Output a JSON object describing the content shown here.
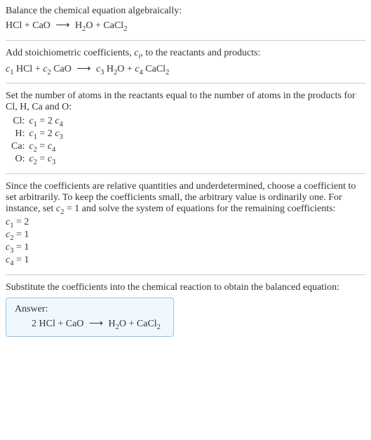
{
  "section1": {
    "title": "Balance the chemical equation algebraically:",
    "equation_parts": {
      "r1": "HCl",
      "r2": "CaO",
      "p1_base": "H",
      "p1_sub": "2",
      "p1_suffix": "O",
      "p2_base": "CaCl",
      "p2_sub": "2"
    }
  },
  "section2": {
    "text_before": "Add stoichiometric coefficients, ",
    "ci_base": "c",
    "ci_sub": "i",
    "text_after": ", to the reactants and products:",
    "c1": "c",
    "c1sub": "1",
    "r1": " HCl",
    "c2": "c",
    "c2sub": "2",
    "r2": " CaO",
    "c3": "c",
    "c3sub": "3",
    "p1a": " H",
    "p1sub": "2",
    "p1b": "O",
    "c4": "c",
    "c4sub": "4",
    "p2a": " CaCl",
    "p2sub": "2"
  },
  "section3": {
    "text": "Set the number of atoms in the reactants equal to the number of atoms in the products for Cl, H, Ca and O:",
    "rows": [
      {
        "label": "Cl:",
        "c": "c",
        "csub": "1",
        "eq": " = 2 ",
        "c2": "c",
        "c2sub": "4"
      },
      {
        "label": "H:",
        "c": "c",
        "csub": "1",
        "eq": " = 2 ",
        "c2": "c",
        "c2sub": "3"
      },
      {
        "label": "Ca:",
        "c": "c",
        "csub": "2",
        "eq": " = ",
        "c2": "c",
        "c2sub": "4"
      },
      {
        "label": "O:",
        "c": "c",
        "csub": "2",
        "eq": " = ",
        "c2": "c",
        "c2sub": "3"
      }
    ]
  },
  "section4": {
    "text_before": "Since the coefficients are relative quantities and underdetermined, choose a coefficient to set arbitrarily. To keep the coefficients small, the arbitrary value is ordinarily one. For instance, set ",
    "set_c": "c",
    "set_csub": "2",
    "set_val": " = 1",
    "text_after": " and solve the system of equations for the remaining coefficients:",
    "coefs": [
      {
        "c": "c",
        "csub": "1",
        "val": " = 2"
      },
      {
        "c": "c",
        "csub": "2",
        "val": " = 1"
      },
      {
        "c": "c",
        "csub": "3",
        "val": " = 1"
      },
      {
        "c": "c",
        "csub": "4",
        "val": " = 1"
      }
    ]
  },
  "section5": {
    "text": "Substitute the coefficients into the chemical reaction to obtain the balanced equation:",
    "answer_label": "Answer:",
    "answer": {
      "coef1": "2 ",
      "r1": "HCl",
      "r2": "CaO",
      "p1a": "H",
      "p1sub": "2",
      "p1b": "O",
      "p2a": "CaCl",
      "p2sub": "2"
    }
  },
  "chart_data": {
    "type": "table",
    "title": "Atom balance equations and solved coefficients",
    "atom_equations": [
      {
        "element": "Cl",
        "equation": "c1 = 2 c4"
      },
      {
        "element": "H",
        "equation": "c1 = 2 c3"
      },
      {
        "element": "Ca",
        "equation": "c2 = c4"
      },
      {
        "element": "O",
        "equation": "c2 = c3"
      }
    ],
    "solved_coefficients": {
      "c1": 2,
      "c2": 1,
      "c3": 1,
      "c4": 1
    },
    "balanced_equation": "2 HCl + CaO -> H2O + CaCl2"
  }
}
